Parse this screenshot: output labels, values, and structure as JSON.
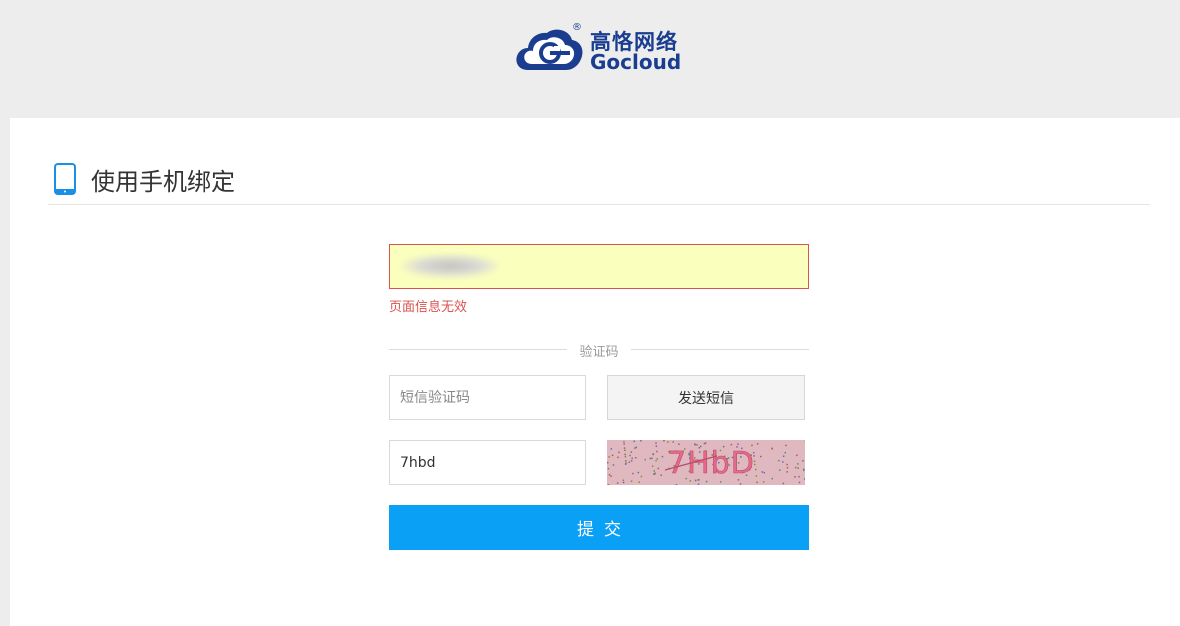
{
  "header": {
    "logo_cn": "高恪网络",
    "logo_en": "Gocloud",
    "logo_reg": "®",
    "logo_icon": "cloud-g-icon"
  },
  "section": {
    "title": "使用手机绑定",
    "icon": "mobile-phone-icon"
  },
  "form": {
    "page_field": {
      "value": "",
      "note": ""
    },
    "error_message": "页面信息无效",
    "divider_label": "验证码",
    "sms_code": {
      "placeholder": "短信验证码",
      "value": ""
    },
    "send_sms_label": "发送短信",
    "captcha_input": {
      "value": "7hbd"
    },
    "captcha_image_text": "7HbD",
    "submit_label": "提交"
  },
  "colors": {
    "brand": "#1a3d8f",
    "accent": "#0aa0f5",
    "error": "#d9534f",
    "page_bg": "#ededed",
    "invalid_field_bg": "#fbffbd"
  }
}
